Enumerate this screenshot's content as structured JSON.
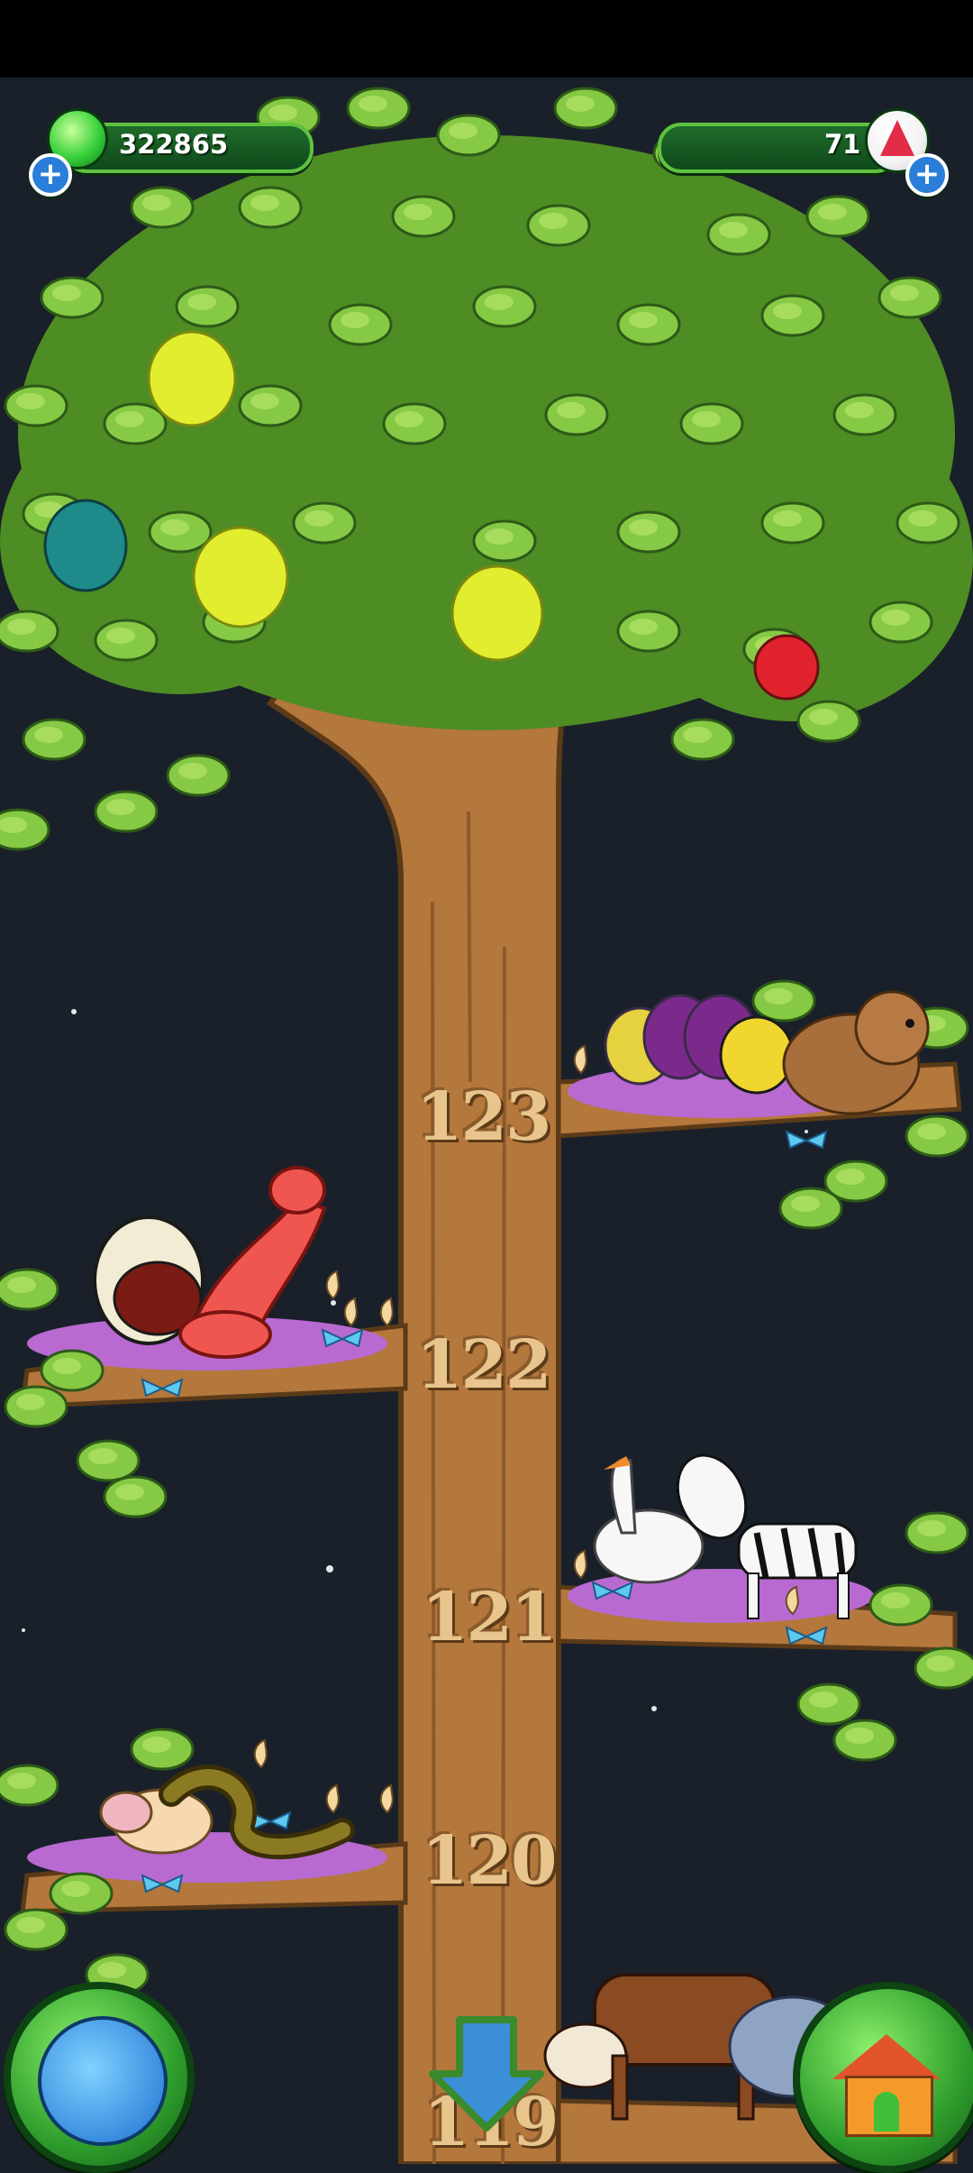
{
  "hud": {
    "gems": {
      "value": "322865",
      "icon": "green-gem-icon",
      "add_icon": "plus-icon"
    },
    "crystals": {
      "value": "71",
      "icon": "red-crystal-icon",
      "add_icon": "plus-icon"
    }
  },
  "branches": [
    {
      "level": "123",
      "animals": [
        "caterpillar",
        "hamster"
      ]
    },
    {
      "level": "122",
      "animals": [
        "moth",
        "shrimp"
      ]
    },
    {
      "level": "121",
      "animals": [
        "swan",
        "zebra"
      ]
    },
    {
      "level": "120",
      "animals": [
        "pig",
        "snake"
      ]
    },
    {
      "level": "119",
      "animals": [
        "bull",
        "donkey"
      ]
    }
  ],
  "fruits": [
    "yellow-fruit",
    "yellow-fruit",
    "yellow-fruit",
    "teal-cone",
    "red-apple"
  ],
  "buttons": {
    "world": {
      "icon": "globe-icon"
    },
    "scroll_down": {
      "icon": "arrow-down-icon"
    },
    "home": {
      "icon": "house-icon"
    }
  },
  "colors": {
    "sky": "#19202a",
    "trunk": "#b4773c",
    "leaf": "#7fc53f",
    "hud_bar": "#1f6b2b"
  }
}
